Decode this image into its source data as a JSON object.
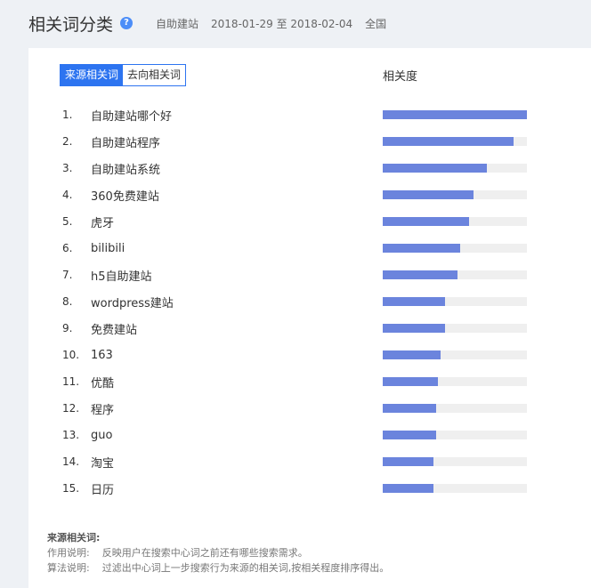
{
  "header": {
    "title": "相关词分类",
    "help": "?",
    "keyword": "自助建站",
    "date_range": "2018-01-29 至 2018-02-04",
    "region": "全国"
  },
  "toggle": {
    "source": "来源相关词",
    "target": "去向相关词"
  },
  "column_header": "相关度",
  "items": [
    {
      "rank": "1.",
      "term": "自助建站哪个好",
      "relevance": 1.0
    },
    {
      "rank": "2.",
      "term": "自助建站程序",
      "relevance": 0.91
    },
    {
      "rank": "3.",
      "term": "自助建站系统",
      "relevance": 0.72
    },
    {
      "rank": "4.",
      "term": "360免费建站",
      "relevance": 0.63
    },
    {
      "rank": "5.",
      "term": "虎牙",
      "relevance": 0.6
    },
    {
      "rank": "6.",
      "term": "bilibili",
      "relevance": 0.54
    },
    {
      "rank": "7.",
      "term": "h5自助建站",
      "relevance": 0.52
    },
    {
      "rank": "8.",
      "term": "wordpress建站",
      "relevance": 0.43
    },
    {
      "rank": "9.",
      "term": "免费建站",
      "relevance": 0.43
    },
    {
      "rank": "10.",
      "term": "163",
      "relevance": 0.4
    },
    {
      "rank": "11.",
      "term": "优酷",
      "relevance": 0.38
    },
    {
      "rank": "12.",
      "term": "程序",
      "relevance": 0.37
    },
    {
      "rank": "13.",
      "term": "guo",
      "relevance": 0.37
    },
    {
      "rank": "14.",
      "term": "淘宝",
      "relevance": 0.35
    },
    {
      "rank": "15.",
      "term": "日历",
      "relevance": 0.35
    }
  ],
  "footer": {
    "title": "来源相关词:",
    "usage_label": "作用说明:",
    "usage_text": "反映用户在搜索中心词之前还有哪些搜索需求。",
    "algo_label": "算法说明:",
    "algo_text": "过滤出中心词上一步搜索行为来源的相关词,按相关程度排序得出。"
  },
  "colors": {
    "accent": "#2d74f0",
    "bar": "#6b84dd",
    "track": "#efefef"
  }
}
